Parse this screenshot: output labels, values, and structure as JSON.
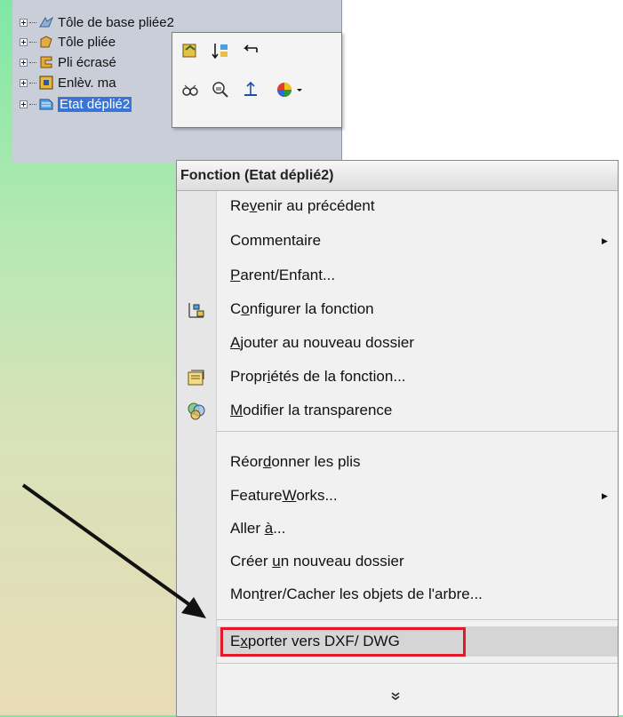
{
  "tree": {
    "items": [
      {
        "label": "Tôle de base pliée2",
        "icon": "sheet-metal-base-icon"
      },
      {
        "label": "Tôle pliée",
        "icon": "sheet-metal-bend-icon"
      },
      {
        "label": "Pli écrasé",
        "icon": "hem-icon"
      },
      {
        "label": "Enlèv. ma",
        "icon": "cut-extrude-icon"
      },
      {
        "label": "Etat déplié2",
        "icon": "flat-pattern-icon"
      }
    ]
  },
  "menu": {
    "header": "Fonction (Etat déplié2)",
    "items": [
      {
        "pre": "Re",
        "acc": "v",
        "post": "enir au précédent"
      },
      {
        "pre": "",
        "acc": "",
        "post": "Commentaire"
      },
      {
        "pre": "",
        "acc": "P",
        "post": "arent/Enfant..."
      },
      {
        "pre": "C",
        "acc": "o",
        "post": "nfigurer la fonction"
      },
      {
        "pre": "",
        "acc": "A",
        "post": "jouter au nouveau dossier"
      },
      {
        "pre": "Propr",
        "acc": "i",
        "post": "étés de la fonction..."
      },
      {
        "pre": "",
        "acc": "M",
        "post": "odifier la transparence"
      },
      {
        "pre": "Réor",
        "acc": "d",
        "post": "onner les plis"
      },
      {
        "pre": "Feature",
        "acc": "W",
        "post": "orks..."
      },
      {
        "pre": "Aller ",
        "acc": "à",
        "post": "..."
      },
      {
        "pre": "Créer ",
        "acc": "u",
        "post": "n nouveau dossier"
      },
      {
        "pre": "Mon",
        "acc": "t",
        "post": "rer/Cacher les objets de l'arbre..."
      },
      {
        "pre": "E",
        "acc": "x",
        "post": "porter vers DXF/ DWG"
      }
    ],
    "expand_glyph": "»"
  },
  "colors": {
    "highlight_box": "#e2192b",
    "selection": "#3a74d6"
  }
}
